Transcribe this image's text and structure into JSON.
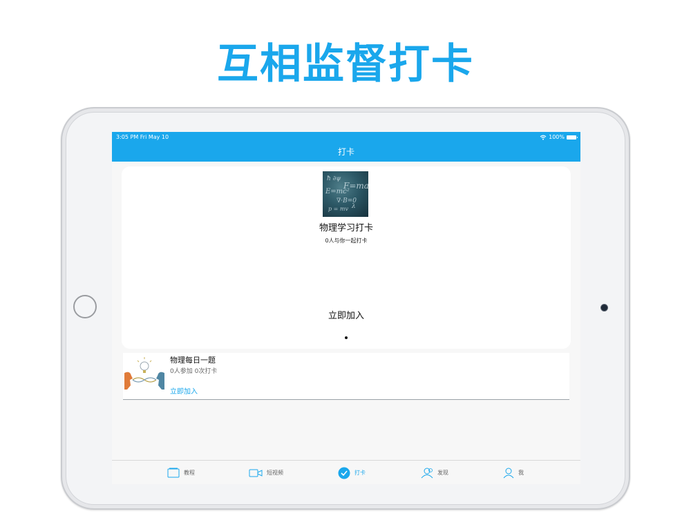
{
  "headline": "互相监督打卡",
  "status_bar": {
    "time": "3:05 PM   Fri May 10",
    "battery": "100%"
  },
  "nav": {
    "title": "打卡"
  },
  "featured": {
    "title": "物理学习打卡",
    "subtitle": "0人与你一起打卡",
    "join_label": "立即加入"
  },
  "list": [
    {
      "title": "物理每日一题",
      "meta": "0人参加 0次打卡",
      "join_label": "立即加入"
    }
  ],
  "tabs": [
    {
      "label": "教程",
      "icon": "book-icon"
    },
    {
      "label": "短视频",
      "icon": "video-camera-icon"
    },
    {
      "label": "打卡",
      "icon": "check-circle-icon",
      "active": true
    },
    {
      "label": "发现",
      "icon": "people-icon"
    },
    {
      "label": "我",
      "icon": "person-icon"
    }
  ],
  "colors": {
    "accent": "#1aa7ec",
    "background": "#f7f7f7"
  }
}
